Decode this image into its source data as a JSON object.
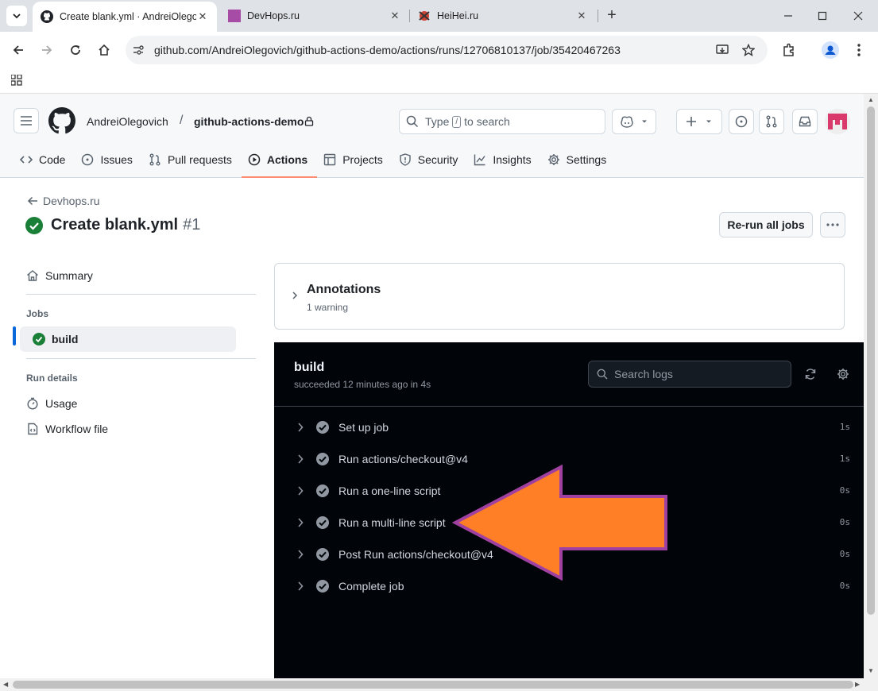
{
  "browser": {
    "tabs": [
      {
        "title": "Create blank.yml · AndreiOlegovich",
        "favicon": "github-icon",
        "active": true
      },
      {
        "title": "DevHops.ru",
        "favicon": "purple-square-icon",
        "active": false
      },
      {
        "title": "HeiHei.ru",
        "favicon": "heihei-icon",
        "active": false
      }
    ],
    "url": "github.com/AndreiOlegovich/github-actions-demo/actions/runs/12706810137/job/35420467263"
  },
  "header": {
    "owner": "AndreiOlegovich",
    "separator": "/",
    "repo": "github-actions-demo",
    "search_prefix": "Type",
    "search_key": "/",
    "search_suffix": "to search",
    "avatar_color": "#d93a6b"
  },
  "repo_nav": [
    {
      "label": "Code",
      "icon": "code-icon"
    },
    {
      "label": "Issues",
      "icon": "issue-icon"
    },
    {
      "label": "Pull requests",
      "icon": "pull-request-icon"
    },
    {
      "label": "Actions",
      "icon": "play-icon",
      "active": true
    },
    {
      "label": "Projects",
      "icon": "table-icon"
    },
    {
      "label": "Security",
      "icon": "shield-icon"
    },
    {
      "label": "Insights",
      "icon": "graph-icon"
    },
    {
      "label": "Settings",
      "icon": "gear-icon"
    }
  ],
  "run": {
    "back_label": "Devhops.ru",
    "title": "Create blank.yml",
    "number": "#1",
    "rerun_label": "Re-run all jobs",
    "status_color": "#1a7f37"
  },
  "sidebar": {
    "summary": "Summary",
    "jobs_heading": "Jobs",
    "job": "build",
    "run_details_heading": "Run details",
    "usage": "Usage",
    "workflow_file": "Workflow file"
  },
  "annotations": {
    "title": "Annotations",
    "subtitle": "1 warning"
  },
  "job_panel": {
    "title": "build",
    "subtitle": "succeeded 12 minutes ago in 4s",
    "search_placeholder": "Search logs",
    "steps": [
      {
        "name": "Set up job",
        "duration": "1s"
      },
      {
        "name": "Run actions/checkout@v4",
        "duration": "1s"
      },
      {
        "name": "Run a one-line script",
        "duration": "0s"
      },
      {
        "name": "Run a multi-line script",
        "duration": "0s"
      },
      {
        "name": "Post Run actions/checkout@v4",
        "duration": "0s"
      },
      {
        "name": "Complete job",
        "duration": "0s"
      }
    ]
  },
  "highlight_arrow": {
    "fill": "#ff7f27",
    "stroke": "#a040a0"
  }
}
